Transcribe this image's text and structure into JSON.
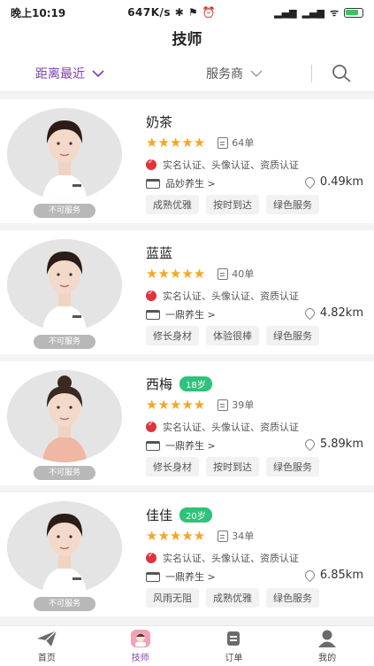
{
  "status": {
    "time": "晚上10:19",
    "network_speed": "647K/s",
    "signal_left": "4G",
    "signal_right": "4G",
    "battery": "87"
  },
  "page_title": "技师",
  "filters": {
    "distance_label": "距离最近",
    "provider_label": "服务商",
    "accent": "#7b3fae"
  },
  "unavailable_label": "不可服务",
  "technicians": [
    {
      "name": "奶茶",
      "age": "",
      "stars": 5,
      "orders": "64单",
      "certs": "实名认证、头像认证、资质认证",
      "store": "品妙养生 >",
      "distance": "0.49km",
      "tags": [
        "成熟优雅",
        "按时到达",
        "绿色服务"
      ],
      "uniform": "#ffffff"
    },
    {
      "name": "蓝蓝",
      "age": "",
      "stars": 5,
      "orders": "40单",
      "certs": "实名认证、头像认证、资质认证",
      "store": "一鼎养生 >",
      "distance": "4.82km",
      "tags": [
        "修长身材",
        "体验很棒",
        "绿色服务"
      ],
      "uniform": "#ffffff"
    },
    {
      "name": "西梅",
      "age": "18岁",
      "stars": 5,
      "orders": "39单",
      "certs": "实名认证、头像认证、资质认证",
      "store": "一鼎养生 >",
      "distance": "5.89km",
      "tags": [
        "修长身材",
        "按时到达",
        "绿色服务"
      ],
      "uniform": "#f0b7a4"
    },
    {
      "name": "佳佳",
      "age": "20岁",
      "stars": 5,
      "orders": "34单",
      "certs": "实名认证、头像认证、资质认证",
      "store": "一鼎养生 >",
      "distance": "6.85km",
      "tags": [
        "风雨无阻",
        "成熟优雅",
        "绿色服务"
      ],
      "uniform": "#ffffff"
    }
  ],
  "tabs": [
    {
      "label": "首页",
      "icon": "paper-plane-icon",
      "active": false
    },
    {
      "label": "技师",
      "icon": "technician-icon",
      "active": true
    },
    {
      "label": "订单",
      "icon": "order-icon",
      "active": false
    },
    {
      "label": "我的",
      "icon": "profile-icon",
      "active": false
    }
  ]
}
